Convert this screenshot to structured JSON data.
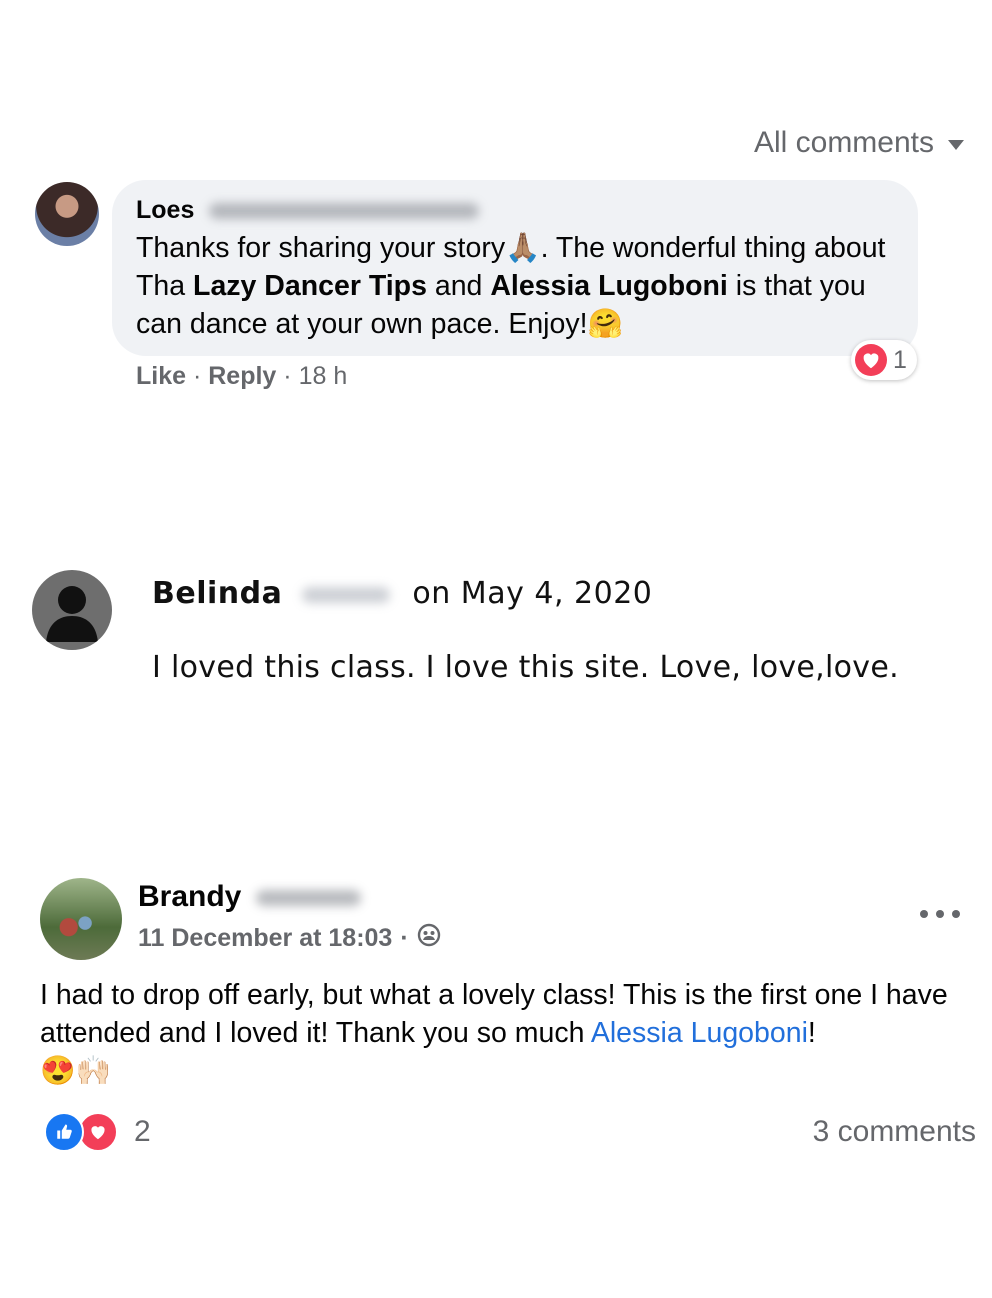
{
  "filter": {
    "label": "All comments"
  },
  "comment": {
    "author_first": "Loes",
    "text_part1": "Thanks for sharing your story",
    "text_part2": ". The wonderful thing about Tha ",
    "bold1": "Lazy Dancer Tips",
    "text_part3": " and ",
    "bold2": "Alessia Lugoboni",
    "text_part4": " is that you can dance at your own pace. Enjoy!",
    "emoji_pray": "🙏🏽",
    "emoji_hug": "🤗",
    "like_label": "Like",
    "sep": " · ",
    "reply_label": "Reply",
    "time": "18 h",
    "reaction_count": "1",
    "reaction_icon": "heart-reaction-icon"
  },
  "review": {
    "author_first": "Belinda",
    "date_text": "on May 4, 2020",
    "text": "I loved this class. I love this site. Love, love,love."
  },
  "post": {
    "author_first": "Brandy",
    "timestamp": "11 December at 18:03",
    "dot": "·",
    "text_part1": "I had to drop off early, but what a lovely class! This is the first one I have attended and I loved it! Thank you so much ",
    "mention": "Alessia Lugoboni",
    "text_part2": "!",
    "emojis": "😍🙌🏻",
    "reaction_count": "2",
    "comments_count": "3 comments",
    "colors": {
      "like": "#1877f2",
      "love": "#f33e58",
      "link": "#216fdb"
    }
  }
}
